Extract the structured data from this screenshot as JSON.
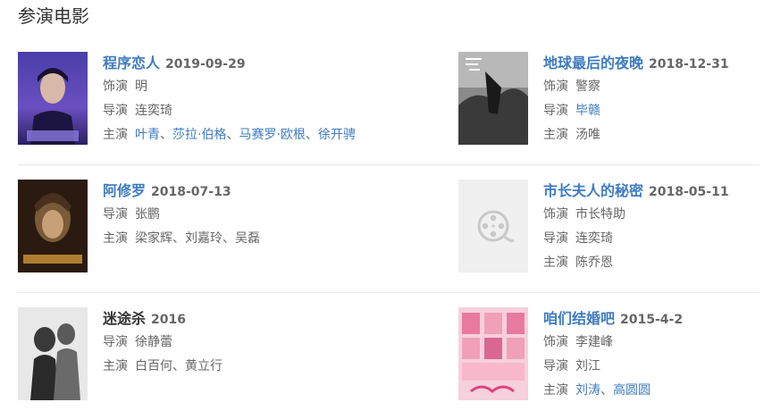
{
  "section_title": "参演电影",
  "movies": [
    {
      "title": "程序恋人",
      "date": "2019-09-29",
      "rows": [
        {
          "label": "饰演",
          "values": [
            "明"
          ],
          "linked": false
        },
        {
          "label": "导演",
          "values": [
            "连奕琦"
          ],
          "linked": false
        },
        {
          "label": "主演",
          "values": [
            "叶青",
            "莎拉·伯格",
            "马赛罗·欧根",
            "徐开骋"
          ],
          "linked": true
        }
      ]
    },
    {
      "title": "地球最后的夜晚",
      "date": "2018-12-31",
      "rows": [
        {
          "label": "饰演",
          "values": [
            "警察"
          ],
          "linked": false
        },
        {
          "label": "导演",
          "values": [
            "毕赣"
          ],
          "linked": true
        },
        {
          "label": "主演",
          "values": [
            "汤唯"
          ],
          "linked": false
        }
      ]
    },
    {
      "title": "阿修罗",
      "date": "2018-07-13",
      "rows": [
        {
          "label": "导演",
          "values": [
            "张鹏"
          ],
          "linked": false
        },
        {
          "label": "主演",
          "values": [
            "梁家辉",
            "刘嘉玲",
            "吴磊"
          ],
          "linked": false
        }
      ]
    },
    {
      "title": "市长夫人的秘密",
      "date": "2018-05-11",
      "rows": [
        {
          "label": "饰演",
          "values": [
            "市长特助"
          ],
          "linked": false
        },
        {
          "label": "导演",
          "values": [
            "连奕琦"
          ],
          "linked": false
        },
        {
          "label": "主演",
          "values": [
            "陈乔恩"
          ],
          "linked": false
        }
      ]
    },
    {
      "title": "迷途杀",
      "date": "2016",
      "rows": [
        {
          "label": "导演",
          "values": [
            "徐静蕾"
          ],
          "linked": false
        },
        {
          "label": "主演",
          "values": [
            "白百何",
            "黄立行"
          ],
          "linked": false
        }
      ]
    },
    {
      "title": "咱们结婚吧",
      "date": "2015-4-2",
      "rows": [
        {
          "label": "饰演",
          "values": [
            "李建峰"
          ],
          "linked": false
        },
        {
          "label": "导演",
          "values": [
            "刘江"
          ],
          "linked": false
        },
        {
          "label": "主演",
          "values": [
            "刘涛",
            "高圆圆"
          ],
          "linked": true
        }
      ]
    }
  ],
  "separator": "、",
  "colors": {
    "link": "#3e7bc0",
    "text": "#666666",
    "divider": "#e8e8e8"
  }
}
